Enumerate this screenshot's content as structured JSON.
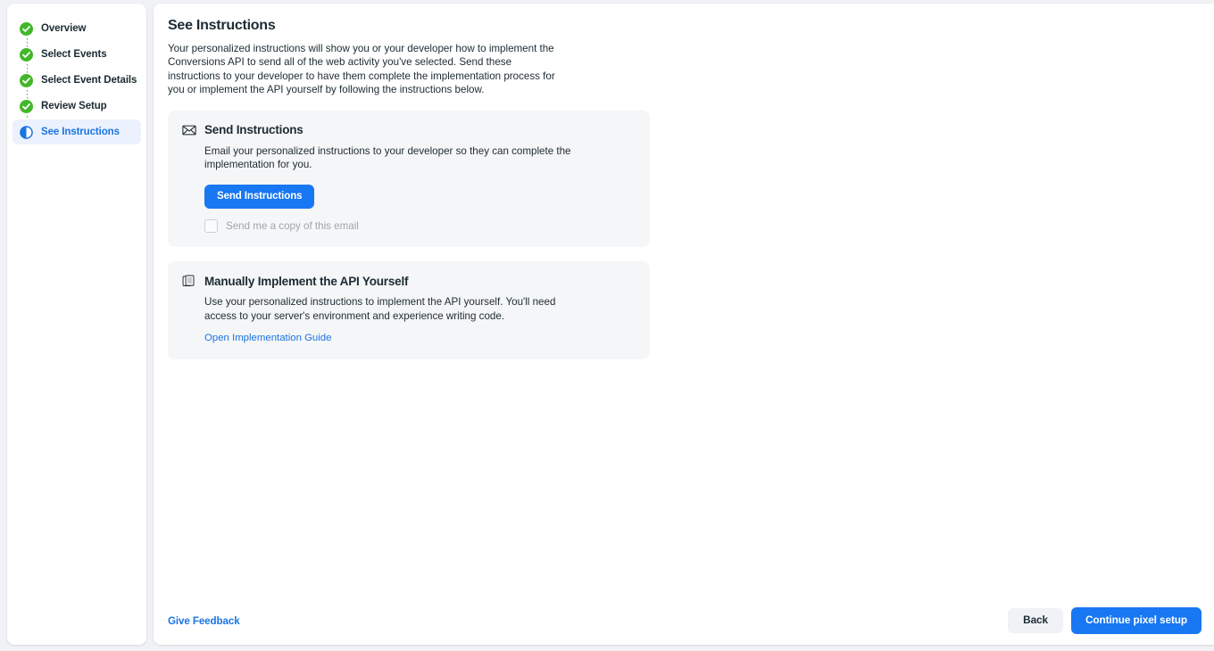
{
  "sidebar": {
    "steps": [
      {
        "label": "Overview",
        "icon": "check-circle-icon",
        "state": "complete"
      },
      {
        "label": "Select Events",
        "icon": "check-circle-icon",
        "state": "complete"
      },
      {
        "label": "Select Event Details",
        "icon": "check-circle-icon",
        "state": "complete"
      },
      {
        "label": "Review Setup",
        "icon": "check-circle-icon",
        "state": "complete"
      },
      {
        "label": "See Instructions",
        "icon": "half-circle-icon",
        "state": "active"
      }
    ]
  },
  "main": {
    "title": "See Instructions",
    "description": "Your personalized instructions will show you or your developer how to implement the Conversions API to send all of the web activity you've selected. Send these instructions to your developer to have them complete the implementation process for you or implement the API yourself by following the instructions below.",
    "panels": [
      {
        "icon": "envelope-icon",
        "title": "Send Instructions",
        "body": "Email your personalized instructions to your developer so they can complete the implementation for you.",
        "button_label": "Send Instructions",
        "checkbox_label": "Send me a copy of this email",
        "checkbox_checked": false,
        "checkbox_disabled": true
      },
      {
        "icon": "stacked-pages-icon",
        "title": "Manually Implement the API Yourself",
        "body": "Use your personalized instructions to implement the API yourself. You'll need access to your server's environment and experience writing code.",
        "link_label": "Open Implementation Guide"
      }
    ]
  },
  "footer": {
    "feedback_label": "Give Feedback",
    "back_label": "Back",
    "continue_label": "Continue pixel setup"
  },
  "colors": {
    "accent_blue": "#1877f2",
    "link_blue": "#1b74e4",
    "complete_green": "#42b72a",
    "panel_bg": "#f5f6f7",
    "page_bg": "#f0f2f5",
    "active_step_bg": "#ebf2fd",
    "text_primary": "#1c2b33",
    "text_disabled": "#a0a5ab"
  }
}
